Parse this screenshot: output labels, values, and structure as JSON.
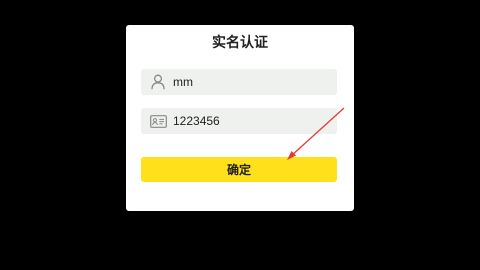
{
  "dialog": {
    "title": "实名认证",
    "name_field": {
      "value": "mm",
      "icon": "person-icon"
    },
    "id_field": {
      "value": "1223456",
      "icon": "id-card-icon"
    },
    "confirm_label": "确定"
  },
  "colors": {
    "background": "#000000",
    "dialog": "#ffffff",
    "field": "#eef1ee",
    "button": "#ffe01b",
    "annotation_arrow": "#e53935"
  }
}
